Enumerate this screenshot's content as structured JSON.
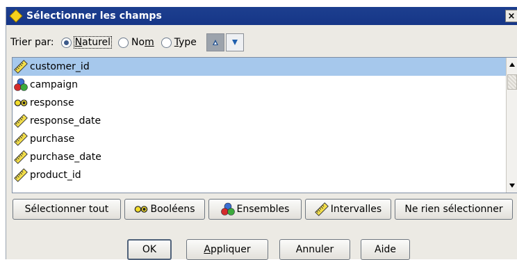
{
  "dialog": {
    "title": "Sélectionner les champs",
    "close_glyph": "×"
  },
  "sort": {
    "label": "Trier par:",
    "options": [
      {
        "pre": "",
        "mnemonic": "N",
        "post": "aturel",
        "checked": true
      },
      {
        "pre": "No",
        "mnemonic": "m",
        "post": "",
        "checked": false
      },
      {
        "pre": "",
        "mnemonic": "T",
        "post": "ype",
        "checked": false
      }
    ],
    "ascending_icon": "triangle-up-icon",
    "descending_icon": "triangle-down-icon"
  },
  "fields": [
    {
      "name": "customer_id",
      "type_icon": "ruler-icon",
      "selected": true
    },
    {
      "name": "campaign",
      "type_icon": "set-icon",
      "selected": false
    },
    {
      "name": "response",
      "type_icon": "flag-icon",
      "selected": false
    },
    {
      "name": "response_date",
      "type_icon": "ruler-icon",
      "selected": false
    },
    {
      "name": "purchase",
      "type_icon": "ruler-icon",
      "selected": false
    },
    {
      "name": "purchase_date",
      "type_icon": "ruler-icon",
      "selected": false
    },
    {
      "name": "product_id",
      "type_icon": "ruler-icon",
      "selected": false
    }
  ],
  "select_buttons": {
    "all": "Sélectionner tout",
    "flags": "Booléens",
    "sets": "Ensembles",
    "ranges": "Intervalles",
    "none": "Ne rien sélectionner"
  },
  "actions": {
    "ok": "OK",
    "apply_mnemonic": "A",
    "apply_rest": "ppliquer",
    "cancel": "Annuler",
    "help": "Aide"
  },
  "colors": {
    "title_bar": "#1d3f8f",
    "selection": "#a6c8ec",
    "dialog_bg": "#eceae4"
  }
}
